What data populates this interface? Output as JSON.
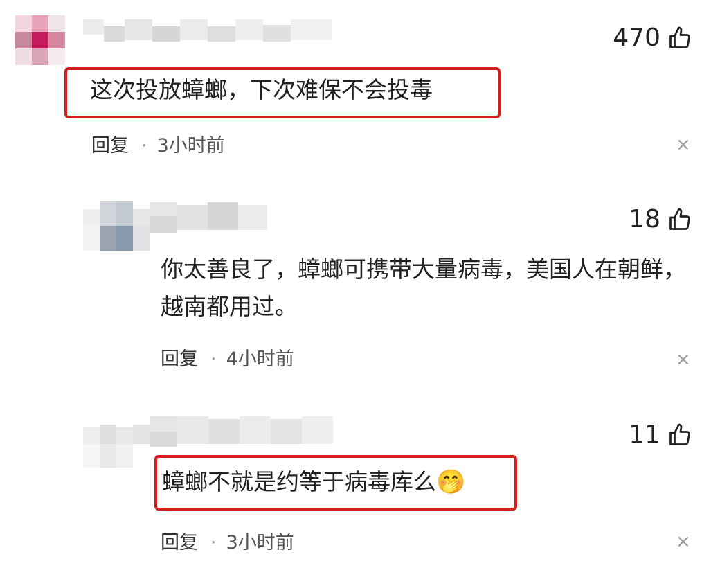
{
  "comments": [
    {
      "text": "这次投放蟑螂，下次难保不会投毒",
      "likes": "470",
      "reply_label": "回复",
      "separator": "·",
      "time": "3小时前",
      "close_glyph": "×"
    },
    {
      "text": "你太善良了，蟑螂可携带大量病毒，美国人在朝鲜，越南都用过。",
      "likes": "18",
      "reply_label": "回复",
      "separator": "·",
      "time": "4小时前",
      "close_glyph": "×"
    },
    {
      "text": "蟑螂不就是约等于病毒库么",
      "emoji": "🤭",
      "likes": "11",
      "reply_label": "回复",
      "separator": "·",
      "time": "3小时前",
      "close_glyph": "×"
    }
  ],
  "colors": {
    "highlight_border": "#d41f1f",
    "text": "#222222",
    "meta": "#555555"
  },
  "icons": [
    "thumbs-up-icon",
    "close-icon",
    "avatar-pixelated",
    "username-pixelated"
  ]
}
